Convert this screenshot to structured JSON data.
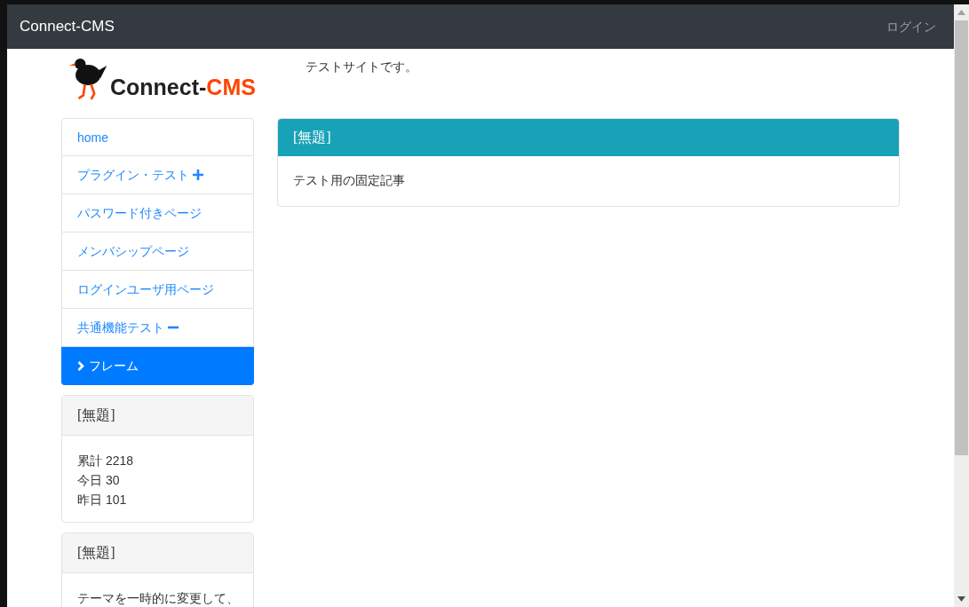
{
  "navbar": {
    "brand": "Connect-CMS",
    "login_link": "ログイン"
  },
  "header": {
    "logo_text_dark": "Connect-",
    "logo_text_accent": "CMS",
    "tagline": "テストサイトです。"
  },
  "menu": [
    {
      "label": "home",
      "kind": "plain",
      "selected": false
    },
    {
      "label": "プラグイン・テスト",
      "kind": "expandable",
      "selected": false
    },
    {
      "label": "パスワード付きページ",
      "kind": "plain",
      "selected": false
    },
    {
      "label": "メンバシップページ",
      "kind": "plain",
      "selected": false
    },
    {
      "label": "ログインユーザ用ページ",
      "kind": "plain",
      "selected": false
    },
    {
      "label": "共通機能テスト",
      "kind": "collapsible",
      "selected": false
    },
    {
      "label": "フレーム",
      "kind": "plain",
      "selected": true
    }
  ],
  "side_frames": [
    {
      "title": "[無題]",
      "lines": [
        "累計 2218",
        "今日 30",
        "昨日 101"
      ]
    },
    {
      "title": "[無題]",
      "lines": [
        "テーマを一時的に変更して、"
      ]
    }
  ],
  "main_frame": {
    "title": "[無題]",
    "body": "テスト用の固定記事"
  }
}
